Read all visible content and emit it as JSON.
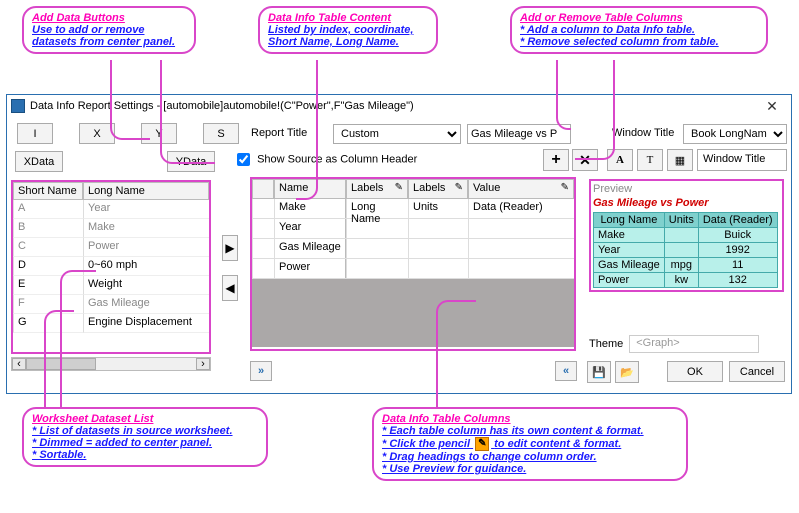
{
  "annotations": {
    "addData": {
      "title": "Add Data Buttons",
      "l1": "Use to add or remove",
      "l2": "datasets from center panel."
    },
    "tableContent": {
      "title": "Data Info Table Content",
      "l1": "Listed by index, coordinate,",
      "l2": "Short Name, Long Name."
    },
    "addRemoveCols": {
      "title": "Add or Remove Table Columns",
      "l1": "* Add a column to Data Info table.",
      "l2": "* Remove selected column from table."
    },
    "wksList": {
      "title": "Worksheet Dataset List",
      "l1": "* List of datasets in source worksheet.",
      "l2": "* Dimmed = added to center panel.",
      "l3": "* Sortable."
    },
    "tableCols": {
      "title": "Data Info Table Columns",
      "l1": "* Each table column has its own content & format.",
      "l2a": "* Click the pencil",
      "l2b": "to edit content & format.",
      "l3": "* Drag headings to change column order.",
      "l4": "* Use Preview for guidance."
    }
  },
  "dialog": {
    "title": "Data Info Report Settings - [automobile]automobile!(C\"Power\",F\"Gas Mileage\")",
    "close": "✕"
  },
  "leftButtons": {
    "i": "I",
    "x": "X",
    "y": "Y",
    "s": "S",
    "xdata": "XData",
    "ydata": "YData"
  },
  "datasetGrid": {
    "h1": "Short Name",
    "h2": "Long Name",
    "rows": [
      {
        "sn": "A",
        "ln": "Year",
        "dim": true
      },
      {
        "sn": "B",
        "ln": "Make",
        "dim": true
      },
      {
        "sn": "C",
        "ln": "Power",
        "dim": true
      },
      {
        "sn": "D",
        "ln": "0~60 mph",
        "dim": false
      },
      {
        "sn": "E",
        "ln": "Weight",
        "dim": false
      },
      {
        "sn": "F",
        "ln": "Gas Mileage",
        "dim": true
      },
      {
        "sn": "G",
        "ln": "Engine Displacement",
        "dim": false
      }
    ]
  },
  "center": {
    "reportTitleLabel": "Report Title",
    "reportMode": "Custom",
    "reportTitleValue": "Gas Mileage vs P",
    "showSource": "Show Source as Column Header",
    "plusLabel": "+",
    "xLabel": "✕",
    "head": {
      "c2": "Name",
      "c3": "Labels",
      "c4": "Labels",
      "c5": "Value",
      "pencil": "✎"
    },
    "rows": [
      {
        "name": "Make",
        "c3": "Long Name",
        "c4": "Units",
        "c5": "Data (Reader)"
      },
      {
        "name": "Year",
        "c3": "",
        "c4": "",
        "c5": ""
      },
      {
        "name": "Gas Mileage",
        "c3": "",
        "c4": "",
        "c5": ""
      },
      {
        "name": "Power",
        "c3": "",
        "c4": "",
        "c5": ""
      }
    ],
    "dblRight": "»",
    "dblLeft": "«"
  },
  "right": {
    "windowTitleLabel": "Window Title",
    "windowTitleMode": "Book LongName Only",
    "fontA": "A",
    "fontT": "T",
    "grid": "▦",
    "winTitleBoxLabel": "Window Title",
    "previewLabel": "Preview",
    "previewTitle": "Gas Mileage vs Power",
    "previewTable": {
      "h": [
        "Long Name",
        "Units",
        "Data (Reader)"
      ],
      "rows": [
        [
          "Make",
          "",
          "Buick"
        ],
        [
          "Year",
          "",
          "1992"
        ],
        [
          "Gas Mileage",
          "mpg",
          "11"
        ],
        [
          "Power",
          "kw",
          "132"
        ]
      ]
    },
    "themeLabel": "Theme",
    "themeValue": "<Graph>",
    "save": "💾",
    "open": "📂",
    "ok": "OK",
    "cancel": "Cancel"
  }
}
